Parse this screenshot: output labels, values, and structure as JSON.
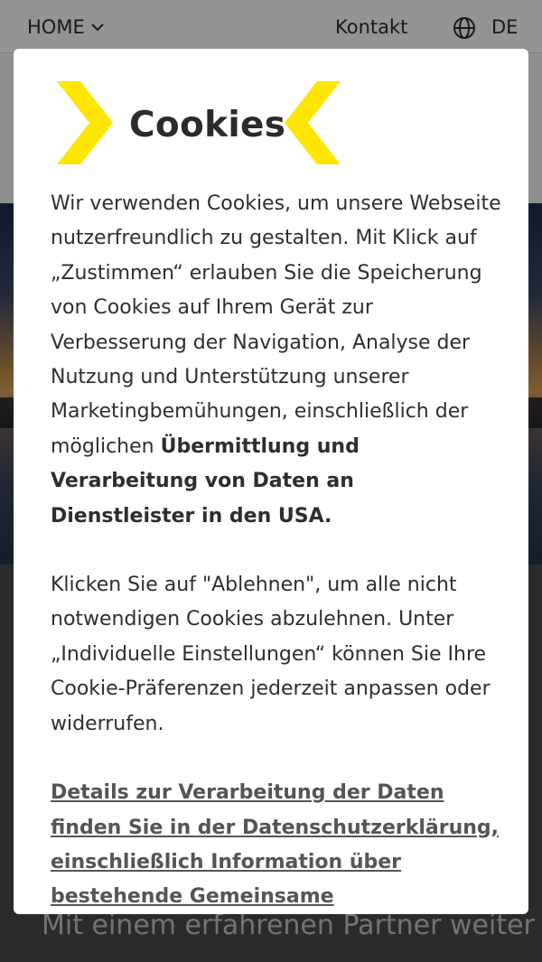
{
  "nav": {
    "home_label": "HOME",
    "contact_label": "Kontakt",
    "language": "DE"
  },
  "background": {
    "teaser_text": "Mit einem erfahrenen Partner weiter wachsen: Raiffeisen Bank"
  },
  "modal": {
    "title": "Cookies",
    "accent_color": "#ffe600",
    "paragraph1": {
      "text": "Wir verwenden Cookies, um unsere Webseite nutzerfreundlich zu gestalten. Mit Klick auf „Zustimmen“ erlauben Sie die Speicherung von Cookies auf Ihrem Gerät zur Verbesserung der Navigation, Analyse der Nutzung und Unterstützung unserer Marketingbemühungen, einschließlich der möglichen ",
      "bold": "Übermittlung und Verarbeitung von Daten an Dienstleister in den USA."
    },
    "paragraph2": "Klicken Sie auf \"Ablehnen\", um alle nicht notwendigen Cookies abzulehnen. Unter „Individuelle Einstellungen“ können Sie Ihre Cookie-Präferenzen jederzeit anpassen oder widerrufen.",
    "privacy_link": "Details zur Verarbeitung der Daten finden Sie in der Datenschutzerklärung, einschließlich Information über bestehende Gemeinsame"
  }
}
